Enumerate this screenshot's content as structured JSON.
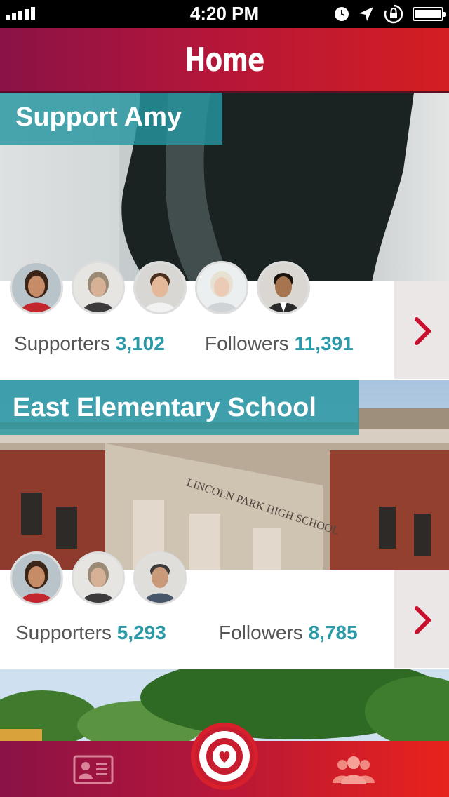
{
  "status_bar": {
    "time": "4:20 PM",
    "icons": [
      "signal-icon",
      "clock-icon",
      "location-arrow-icon",
      "rotation-lock-icon",
      "battery-icon"
    ]
  },
  "nav": {
    "title": "Home"
  },
  "colors": {
    "brand_red": "#d41e22",
    "brand_magenta": "#8a1246",
    "teal": "#2a9aa8",
    "banner_teal": "#2696a0"
  },
  "cards": [
    {
      "title": "Support Amy",
      "supporters_label": "Supporters",
      "supporters_count": "3,102",
      "followers_label": "Followers",
      "followers_count": "11,391",
      "avatars": 5
    },
    {
      "title": "East Elementary School",
      "supporters_label": "Supporters",
      "supporters_count": "5,293",
      "followers_label": "Followers",
      "followers_count": "8,785",
      "avatars": 3,
      "building_inscription": "LINCOLN PARK HIGH SCHOOL"
    }
  ],
  "tab_bar": {
    "items": [
      "contact-card-icon",
      "target-heart-icon",
      "people-icon"
    ]
  }
}
